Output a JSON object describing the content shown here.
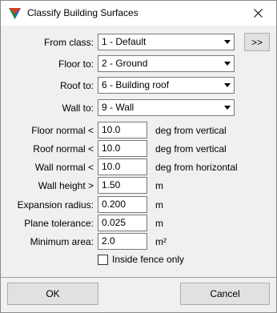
{
  "window": {
    "title": "Classify Building Surfaces",
    "app_icon": "terrasolid-triangle-icon",
    "close_icon": "close-x-icon"
  },
  "class_rows": [
    {
      "label": "From class:",
      "value": "1 - Default"
    },
    {
      "label": "Floor to:",
      "value": "2 - Ground"
    },
    {
      "label": "Roof to:",
      "value": "6 - Building roof"
    },
    {
      "label": "Wall to:",
      "value": "9 - Wall"
    }
  ],
  "more_button": ">>",
  "params": [
    {
      "label": "Floor normal <",
      "value": "10.0",
      "unit": "deg from vertical"
    },
    {
      "label": "Roof normal <",
      "value": "10.0",
      "unit": "deg from vertical"
    },
    {
      "label": "Wall normal <",
      "value": "10.0",
      "unit": "deg from horizontal"
    },
    {
      "label": "Wall height >",
      "value": "1.50",
      "unit": "m"
    },
    {
      "label": "Expansion radius:",
      "value": "0.200",
      "unit": "m"
    },
    {
      "label": "Plane tolerance:",
      "value": "0.025",
      "unit": "m"
    },
    {
      "label": "Minimum area:",
      "value": "2.0",
      "unit": "m²"
    }
  ],
  "inside_fence": {
    "label": "Inside fence only",
    "checked": false
  },
  "buttons": {
    "ok": "OK",
    "cancel": "Cancel"
  },
  "colors": {
    "window_bg": "#f0f0f0",
    "titlebar_bg": "#ffffff",
    "border": "#7a7a7a"
  }
}
